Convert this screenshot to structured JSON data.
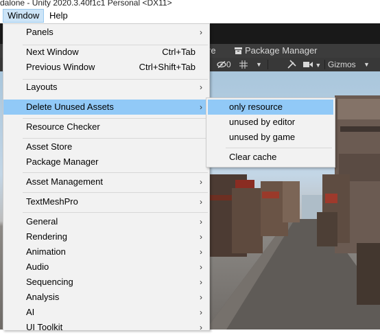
{
  "window_title": "dalone - Unity 2020.3.40f1c1 Personal <DX11>",
  "menubar": {
    "window": "Window",
    "help": "Help"
  },
  "tabs": {
    "partial": "re",
    "package_manager": "Package Manager"
  },
  "scene_toolbar": {
    "hidden_count": "0",
    "gizmos": "Gizmos"
  },
  "window_menu": {
    "panels": "Panels",
    "next_window": "Next Window",
    "next_window_shortcut": "Ctrl+Tab",
    "previous_window": "Previous Window",
    "previous_window_shortcut": "Ctrl+Shift+Tab",
    "layouts": "Layouts",
    "delete_unused_assets": "Delete Unused Assets",
    "resource_checker": "Resource Checker",
    "asset_store": "Asset Store",
    "package_manager": "Package Manager",
    "asset_management": "Asset Management",
    "textmeshpro": "TextMeshPro",
    "general": "General",
    "rendering": "Rendering",
    "animation": "Animation",
    "audio": "Audio",
    "sequencing": "Sequencing",
    "analysis": "Analysis",
    "ai": "AI",
    "ui_toolkit": "UI Toolkit"
  },
  "submenu": {
    "only_resource": "only resource",
    "unused_by_editor": "unused by editor",
    "unused_by_game": "unused by game",
    "clear_cache": "Clear cache"
  },
  "colors": {
    "highlight": "#91c9f7",
    "menu_bg": "#f2f2f2",
    "menubar_active": "#cce4f7"
  }
}
